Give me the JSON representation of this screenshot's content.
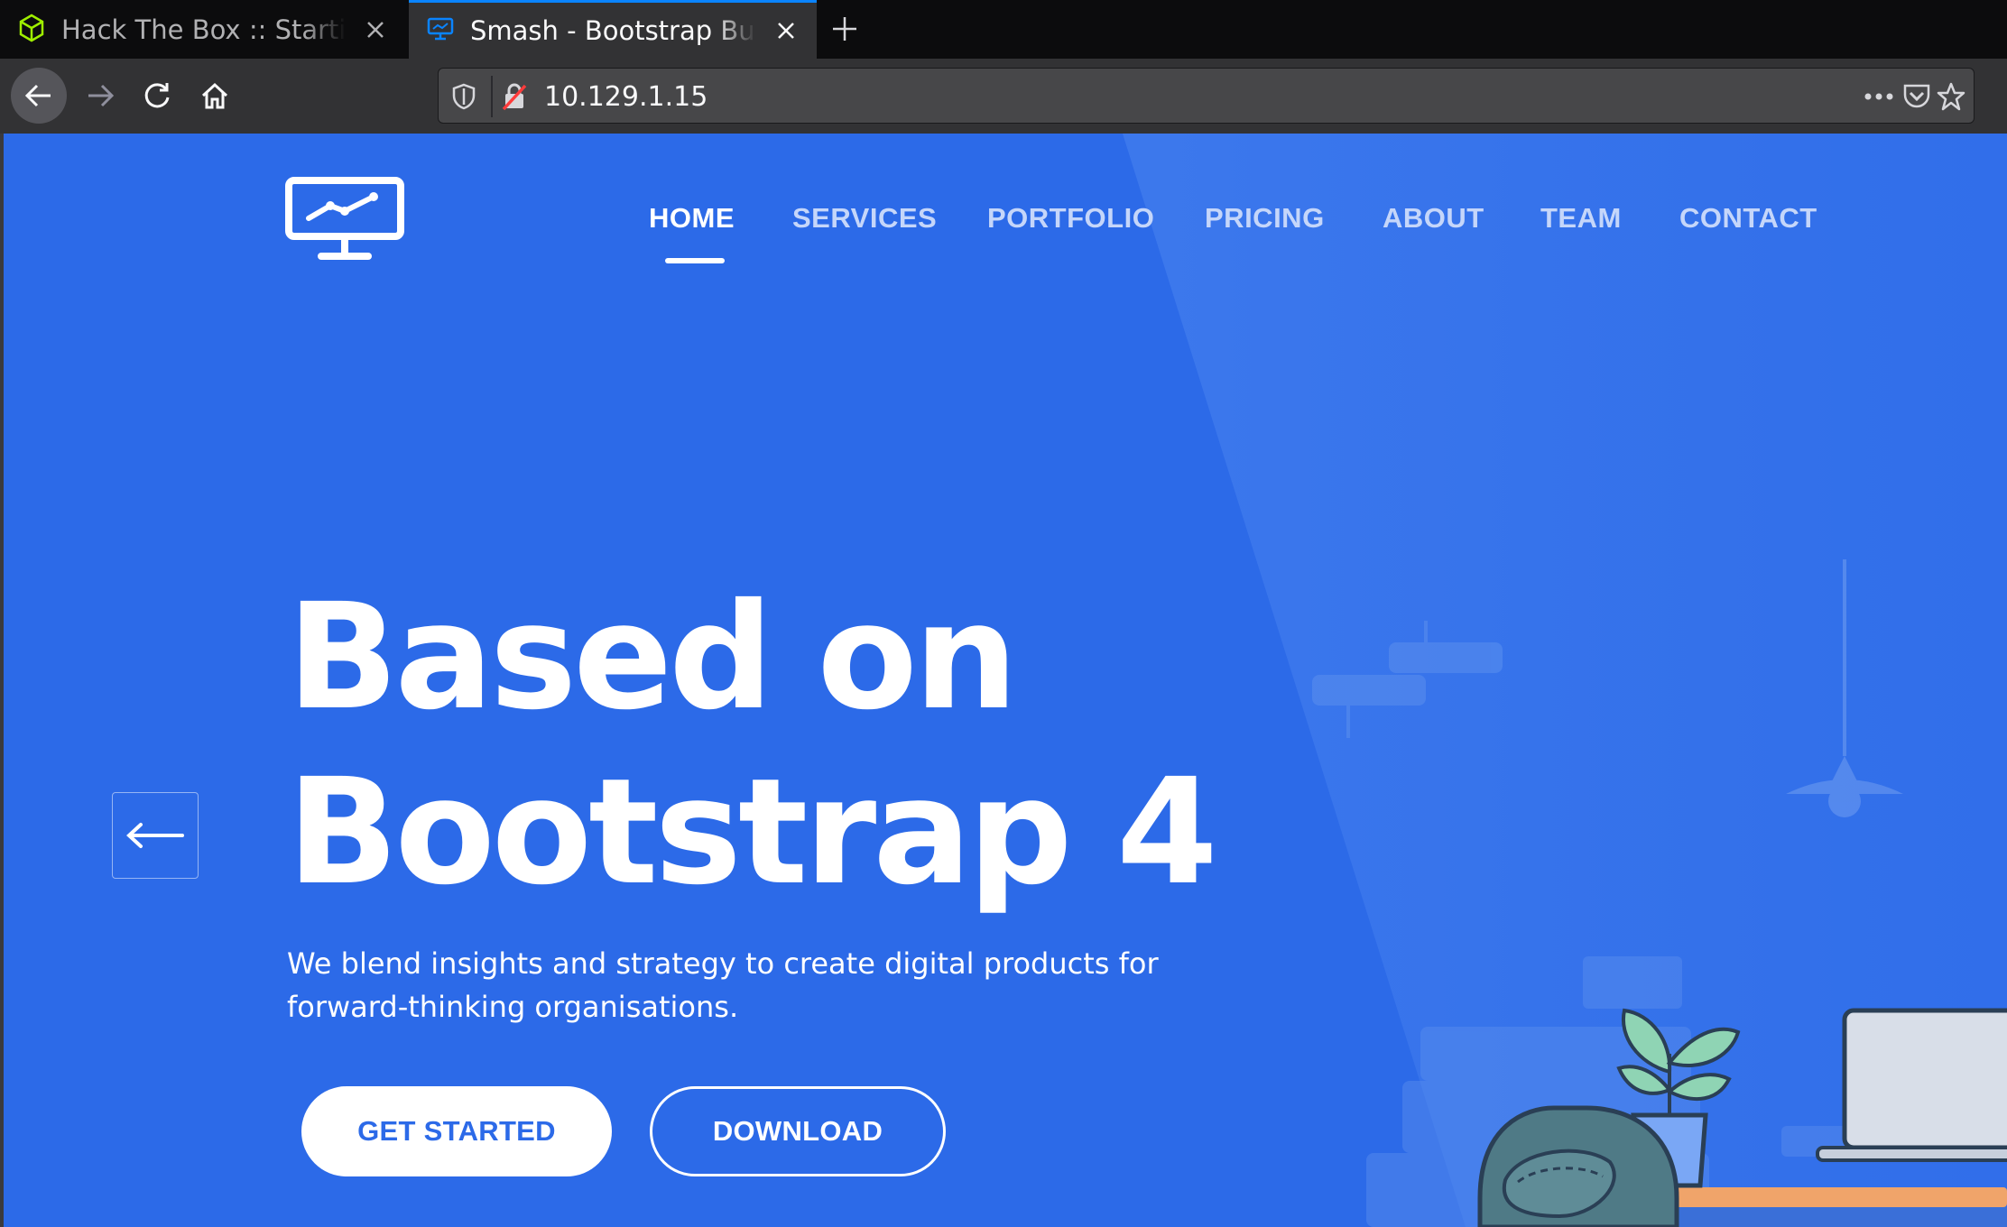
{
  "browser": {
    "tabs": [
      {
        "title": "Hack The Box :: Starting Point",
        "icon": "htb-cube-icon",
        "active": false
      },
      {
        "title": "Smash - Bootstrap Business Template",
        "icon": "monitor-chart-icon",
        "active": true
      }
    ],
    "url": "10.129.1.15",
    "accent": "#0a84ff"
  },
  "page": {
    "brand_color": "#2c6ae8",
    "nav": {
      "items": [
        "HOME",
        "SERVICES",
        "PORTFOLIO",
        "PRICING",
        "ABOUT",
        "TEAM",
        "CONTACT"
      ],
      "active": "HOME"
    },
    "hero": {
      "title_line1": "Based on",
      "title_line2": "Bootstrap 4",
      "subtitle": "We blend insights and strategy to create digital products for forward-thinking organisations.",
      "primary_button": "GET STARTED",
      "secondary_button": "DOWNLOAD"
    },
    "carousel_prev_icon": "arrow-left-icon"
  }
}
